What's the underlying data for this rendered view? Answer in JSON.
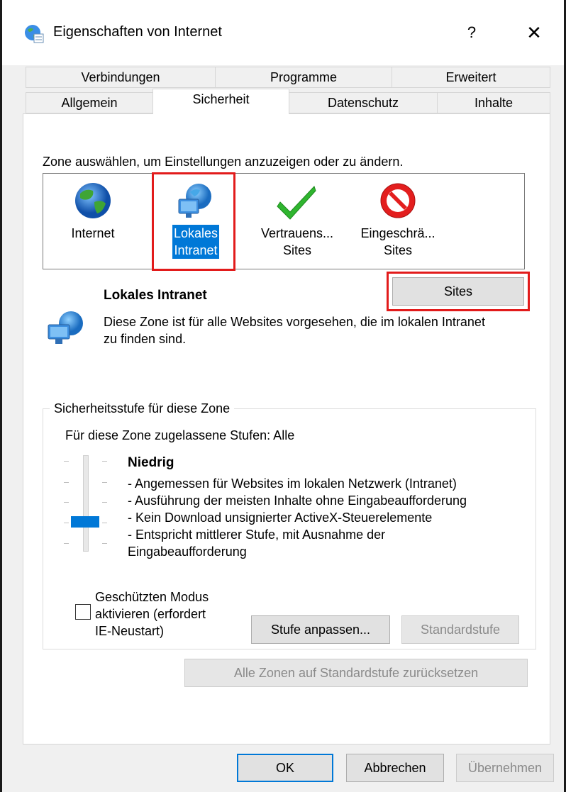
{
  "window": {
    "title": "Eigenschaften von Internet",
    "help_label": "?",
    "close_label": "✕"
  },
  "tabs": {
    "row1": [
      "Verbindungen",
      "Programme",
      "Erweitert"
    ],
    "row2": [
      "Allgemein",
      "Sicherheit",
      "Datenschutz",
      "Inhalte"
    ],
    "active": "Sicherheit"
  },
  "security": {
    "zone_prompt": "Zone auswählen, um Einstellungen anzuzeigen oder zu ändern.",
    "zones": [
      {
        "line1": "Internet",
        "line2": "",
        "icon": "globe-icon"
      },
      {
        "line1": "Lokales",
        "line2": "Intranet",
        "icon": "intranet-icon"
      },
      {
        "line1": "Vertrauens...",
        "line2": "Sites",
        "icon": "checkmark-icon"
      },
      {
        "line1": "Eingeschrä...",
        "line2": "Sites",
        "icon": "restricted-icon"
      }
    ],
    "selected_zone": "Lokales Intranet",
    "sites_button": "Sites",
    "zone_name": "Lokales Intranet",
    "zone_description": "Diese Zone ist für alle Websites vorgesehen, die im lokalen Intranet zu finden sind.",
    "level_group_title": "Sicherheitsstufe für diese Zone",
    "allowed_levels": "Für diese Zone zugelassene Stufen: Alle",
    "level_name": "Niedrig",
    "level_lines": [
      "- Angemessen für Websites im lokalen Netzwerk (Intranet)",
      "- Ausführung der meisten Inhalte ohne Eingabeaufforderung",
      "- Kein Download unsignierter ActiveX-Steuerelemente",
      "- Entspricht mittlerer Stufe, mit Ausnahme der",
      "Eingabeaufforderung"
    ],
    "slider_level_index_from_top": 3,
    "slider_levels": 5,
    "protected_mode_lines": [
      "Geschützten Modus",
      "aktivieren (erfordert",
      "IE-Neustart)"
    ],
    "protected_mode_checked": false,
    "custom_level_button": "Stufe anpassen...",
    "default_level_button": "Standardstufe",
    "reset_all_button": "Alle Zonen auf Standardstufe zurücksetzen"
  },
  "footer": {
    "ok": "OK",
    "cancel": "Abbrechen",
    "apply": "Übernehmen"
  },
  "colors": {
    "highlight": "#0078d7",
    "annotation_red": "#e21b1b",
    "disabled_text": "#8a8a8a"
  }
}
